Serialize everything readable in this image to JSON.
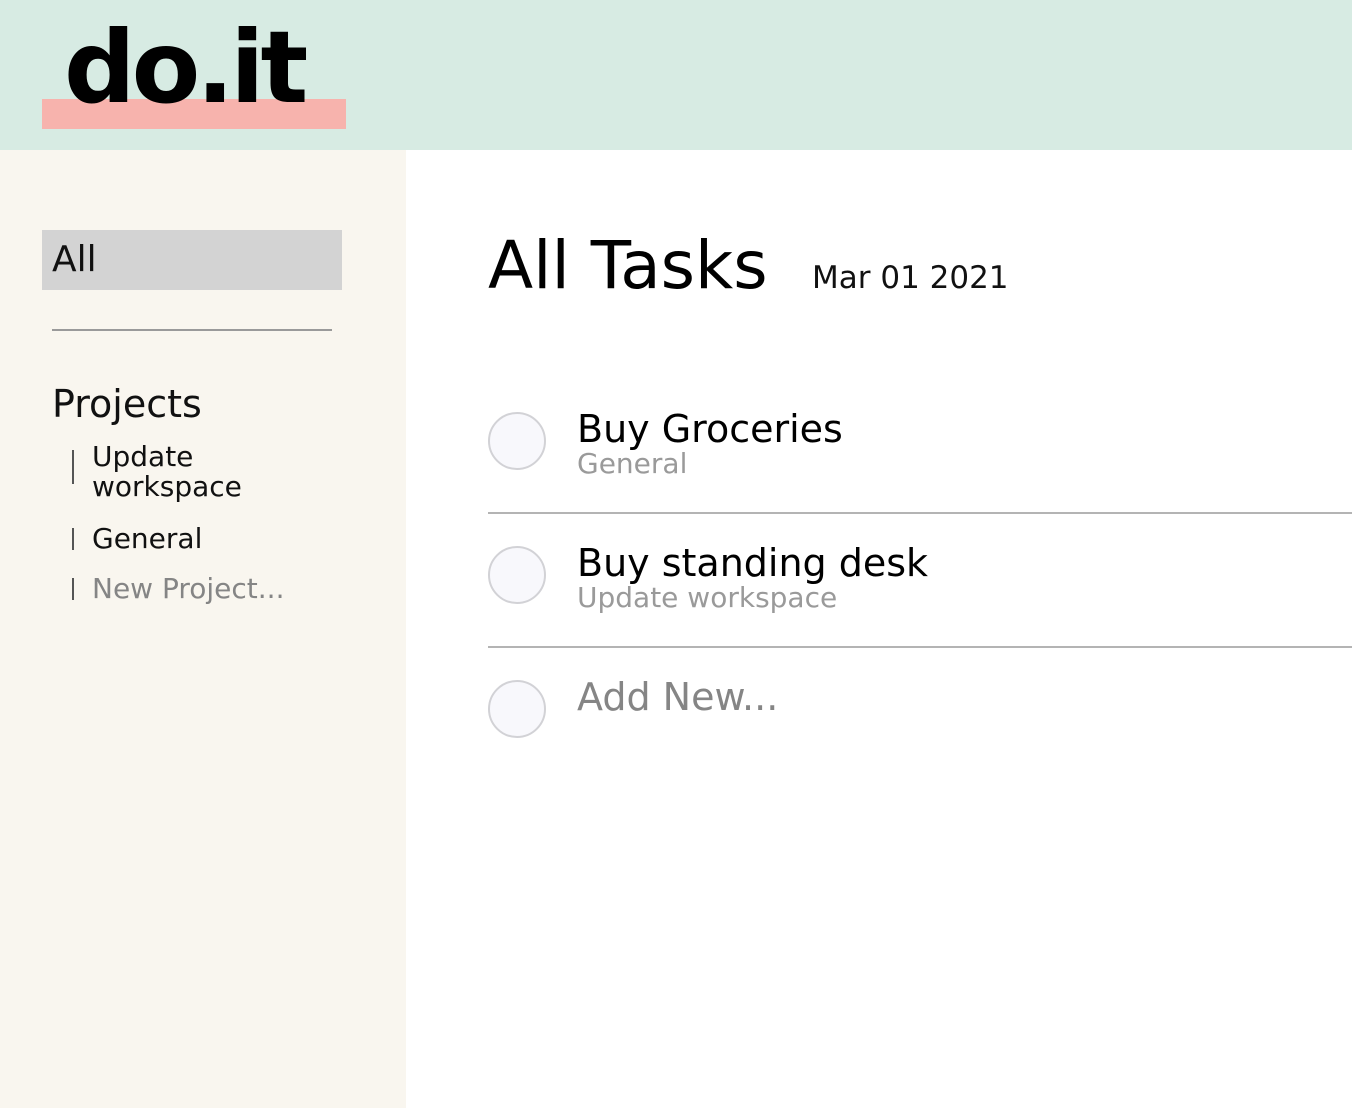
{
  "header": {
    "logo_text": "do.it"
  },
  "sidebar": {
    "all_label": "All",
    "projects_heading": "Projects",
    "projects": [
      {
        "label": "Update workspace"
      },
      {
        "label": "General"
      }
    ],
    "new_project_label": "New Project..."
  },
  "main": {
    "title": "All Tasks",
    "date": "Mar 01 2021",
    "tasks": [
      {
        "title": "Buy Groceries",
        "project": "General"
      },
      {
        "title": "Buy standing desk",
        "project": "Update workspace"
      }
    ],
    "add_new_label": "Add New..."
  },
  "colors": {
    "header_bg": "#d7ebe3",
    "logo_highlight": "#f7b3ad",
    "sidebar_bg": "#f9f6ef",
    "selected_bg": "#d3d3d3",
    "muted_text": "#858585"
  }
}
